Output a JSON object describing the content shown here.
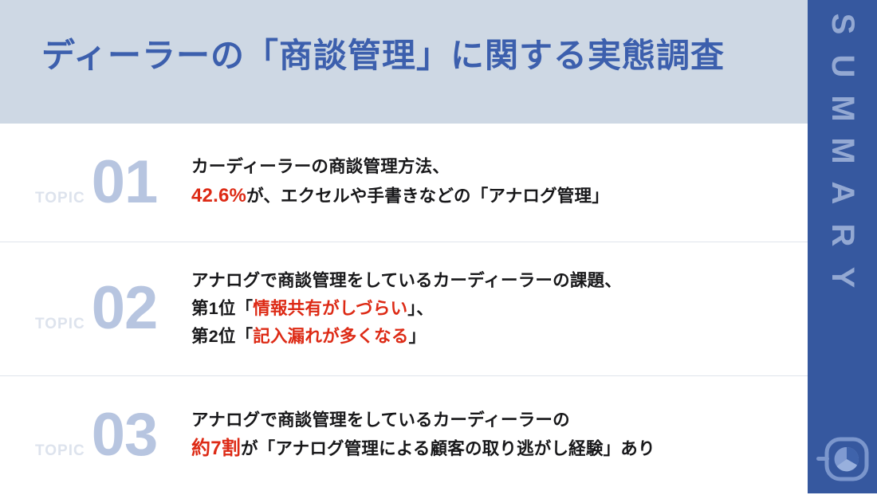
{
  "slide": {
    "title": "ディーラーの「商談管理」に関する実態調査",
    "side_label": "SUMMARY",
    "side_label_letters": [
      "S",
      "U",
      "M",
      "M",
      "A",
      "R",
      "Y"
    ],
    "colors": {
      "header_band": "#ced8e4",
      "title_blue": "#3c5fad",
      "side_bar_blue": "#36589f",
      "side_label_blue": "#93a8d2",
      "topic_number_blue": "#b7c5e0",
      "topic_kicker_gray": "#dde3ed",
      "highlight_red": "#dd2a15",
      "body_black": "#18181a",
      "divider_gray": "#dfe4ec"
    },
    "logo_icon": "magnifier-pie-chart-icon"
  },
  "topics": [
    {
      "kicker": "TOPIC",
      "number": "01",
      "lines": [
        {
          "segments": [
            {
              "text": "カーディーラーの商談管理方法、",
              "style": "normal"
            }
          ]
        },
        {
          "segments": [
            {
              "text": "42.6%",
              "style": "number"
            },
            {
              "text": "が、エクセルや手書きなどの「アナログ管理」",
              "style": "normal"
            }
          ]
        }
      ]
    },
    {
      "kicker": "TOPIC",
      "number": "02",
      "lines": [
        {
          "segments": [
            {
              "text": "アナログで商談管理をしているカーディーラーの課題、",
              "style": "normal"
            }
          ]
        },
        {
          "segments": [
            {
              "text": "第1位「",
              "style": "normal"
            },
            {
              "text": "情報共有がしづらい",
              "style": "highlight"
            },
            {
              "text": "」、",
              "style": "normal"
            }
          ]
        },
        {
          "segments": [
            {
              "text": "第2位「",
              "style": "normal"
            },
            {
              "text": "記入漏れが多くなる",
              "style": "highlight"
            },
            {
              "text": "」",
              "style": "normal"
            }
          ]
        }
      ]
    },
    {
      "kicker": "TOPIC",
      "number": "03",
      "lines": [
        {
          "segments": [
            {
              "text": "アナログで商談管理をしているカーディーラーの",
              "style": "normal"
            }
          ]
        },
        {
          "segments": [
            {
              "text": "約7割",
              "style": "number"
            },
            {
              "text": "が「アナログ管理による顧客の取り逃がし経験」あり",
              "style": "normal"
            }
          ]
        }
      ]
    }
  ]
}
